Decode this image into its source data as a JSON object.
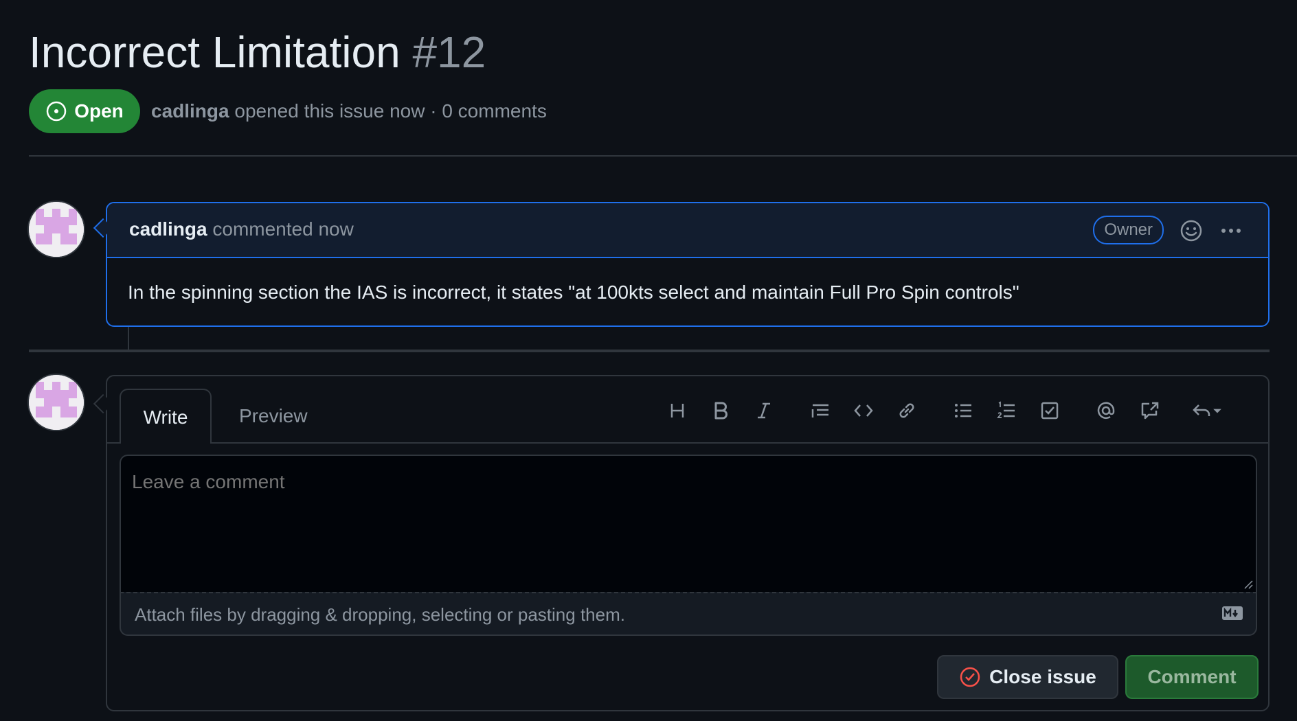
{
  "issue": {
    "title": "Incorrect Limitation",
    "number": "#12",
    "state": "Open",
    "author": "cadlinga",
    "meta_text": "opened this issue now · 0 comments"
  },
  "comment": {
    "author": "cadlinga",
    "action": "commented now",
    "role_badge": "Owner",
    "body": "In the spinning section the IAS is incorrect, it states \"at 100kts select and maintain Full Pro Spin controls\""
  },
  "editor": {
    "tabs": [
      "Write",
      "Preview"
    ],
    "placeholder": "Leave a comment",
    "attach_hint": "Attach files by dragging & dropping, selecting or pasting them.",
    "toolbar": [
      "heading-icon",
      "bold-icon",
      "italic-icon",
      "quote-icon",
      "code-icon",
      "link-icon",
      "unordered-list-icon",
      "ordered-list-icon",
      "task-list-icon",
      "mention-icon",
      "reference-icon",
      "saved-replies-icon"
    ]
  },
  "actions": {
    "close_label": "Close issue",
    "comment_label": "Comment"
  },
  "colors": {
    "open_green": "#238636",
    "accent_blue": "#1f6feb",
    "close_red": "#f85149"
  }
}
